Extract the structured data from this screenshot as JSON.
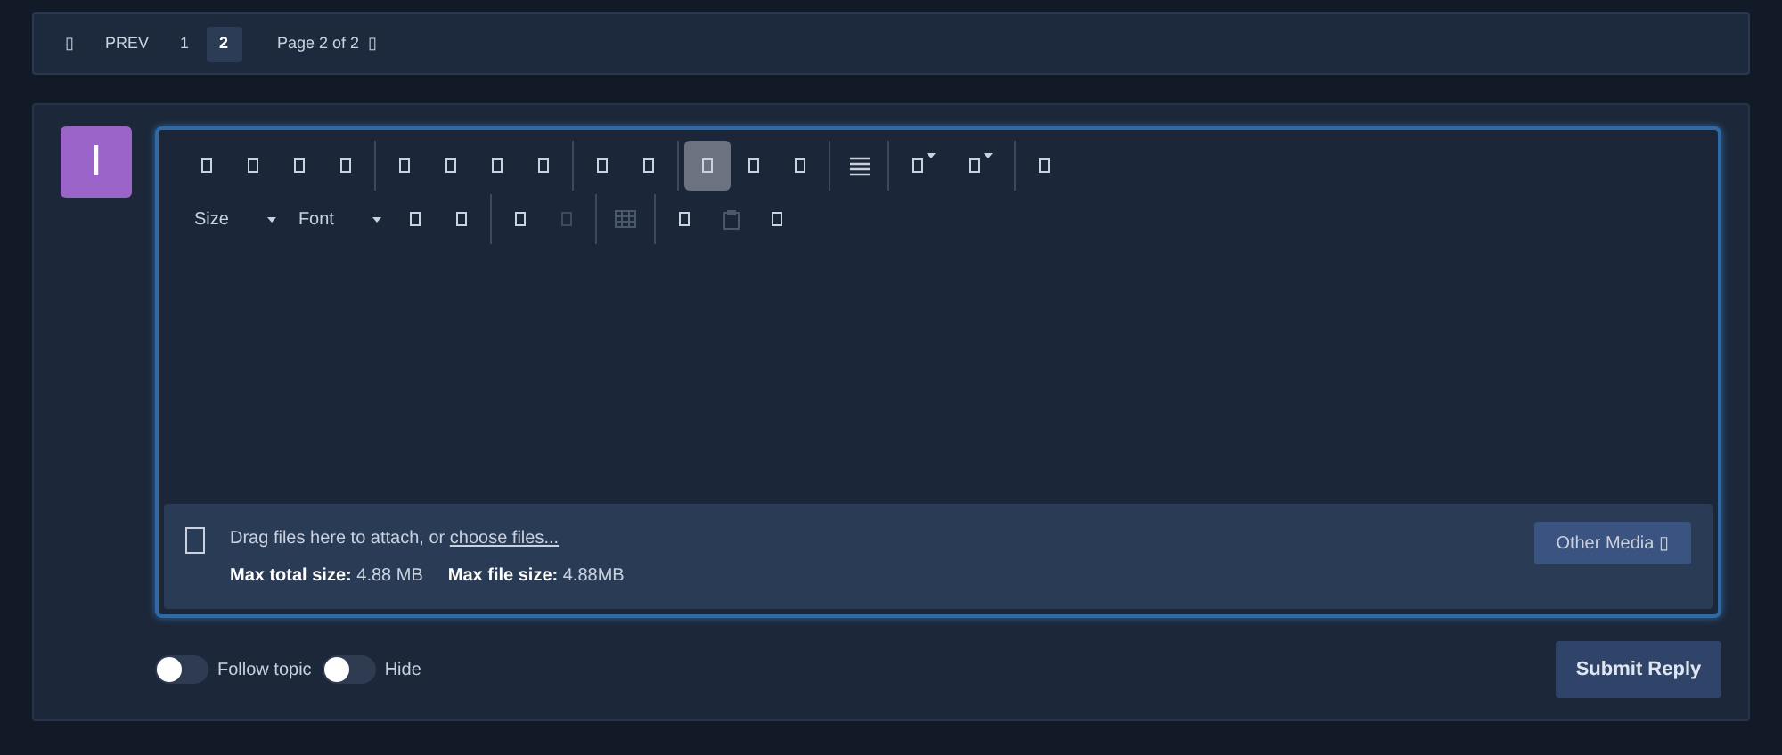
{
  "pagination": {
    "prev_icon": "▯",
    "prev": "PREV",
    "pages": [
      {
        "label": "1",
        "selected": false
      },
      {
        "label": "2",
        "selected": true
      }
    ],
    "summary": "Page 2 of 2",
    "summary_icon": "▯"
  },
  "avatar": {
    "letter": "I",
    "color": "#9b64c8"
  },
  "toolbar": {
    "rows": [
      [
        [
          {
            "kind": "glyph",
            "selected": false,
            "disabled": false
          },
          {
            "kind": "glyph",
            "selected": false,
            "disabled": false
          },
          {
            "kind": "glyph",
            "selected": false,
            "disabled": false
          },
          {
            "kind": "glyph",
            "selected": false,
            "disabled": false
          }
        ],
        [
          {
            "kind": "glyph",
            "selected": false,
            "disabled": false
          },
          {
            "kind": "glyph",
            "selected": false,
            "disabled": false
          },
          {
            "kind": "glyph",
            "selected": false,
            "disabled": false
          },
          {
            "kind": "glyph",
            "selected": false,
            "disabled": false
          }
        ],
        [
          {
            "kind": "glyph",
            "selected": false,
            "disabled": false
          },
          {
            "kind": "glyph",
            "selected": false,
            "disabled": false
          }
        ],
        [
          {
            "kind": "glyph",
            "selected": true,
            "disabled": false
          },
          {
            "kind": "glyph",
            "selected": false,
            "disabled": false
          },
          {
            "kind": "glyph",
            "selected": false,
            "disabled": false
          }
        ],
        [
          {
            "kind": "lines",
            "selected": false,
            "disabled": false
          }
        ],
        [
          {
            "kind": "glyph-menu",
            "selected": false,
            "disabled": false
          },
          {
            "kind": "glyph-menu",
            "selected": false,
            "disabled": false
          }
        ],
        [
          {
            "kind": "glyph",
            "selected": false,
            "disabled": false
          }
        ]
      ],
      [
        [
          {
            "kind": "text-menu",
            "label": "Size",
            "selected": false,
            "disabled": false
          },
          {
            "kind": "text-menu",
            "label": "Font",
            "selected": false,
            "disabled": false
          },
          {
            "kind": "glyph",
            "selected": false,
            "disabled": false
          },
          {
            "kind": "glyph",
            "selected": false,
            "disabled": false
          }
        ],
        [
          {
            "kind": "glyph",
            "selected": false,
            "disabled": false
          },
          {
            "kind": "glyph",
            "selected": false,
            "disabled": true
          }
        ],
        [
          {
            "kind": "table",
            "selected": false,
            "disabled": true
          }
        ],
        [
          {
            "kind": "glyph",
            "selected": false,
            "disabled": false
          },
          {
            "kind": "clipboard",
            "selected": false,
            "disabled": true
          },
          {
            "kind": "glyph",
            "selected": false,
            "disabled": false
          }
        ]
      ]
    ]
  },
  "attachments": {
    "prompt": "Drag files here to attach, or",
    "link": "choose files...",
    "limits": [
      {
        "label": "Max total size:",
        "value": "4.88 MB"
      },
      {
        "label": "Max file size:",
        "value": "4.88MB"
      }
    ],
    "other_media": "Other Media",
    "other_media_icon": "▯"
  },
  "toggles": [
    {
      "label": "Follow topic",
      "on": false
    },
    {
      "label": "Hide",
      "on": false
    }
  ],
  "submit": "Submit Reply"
}
